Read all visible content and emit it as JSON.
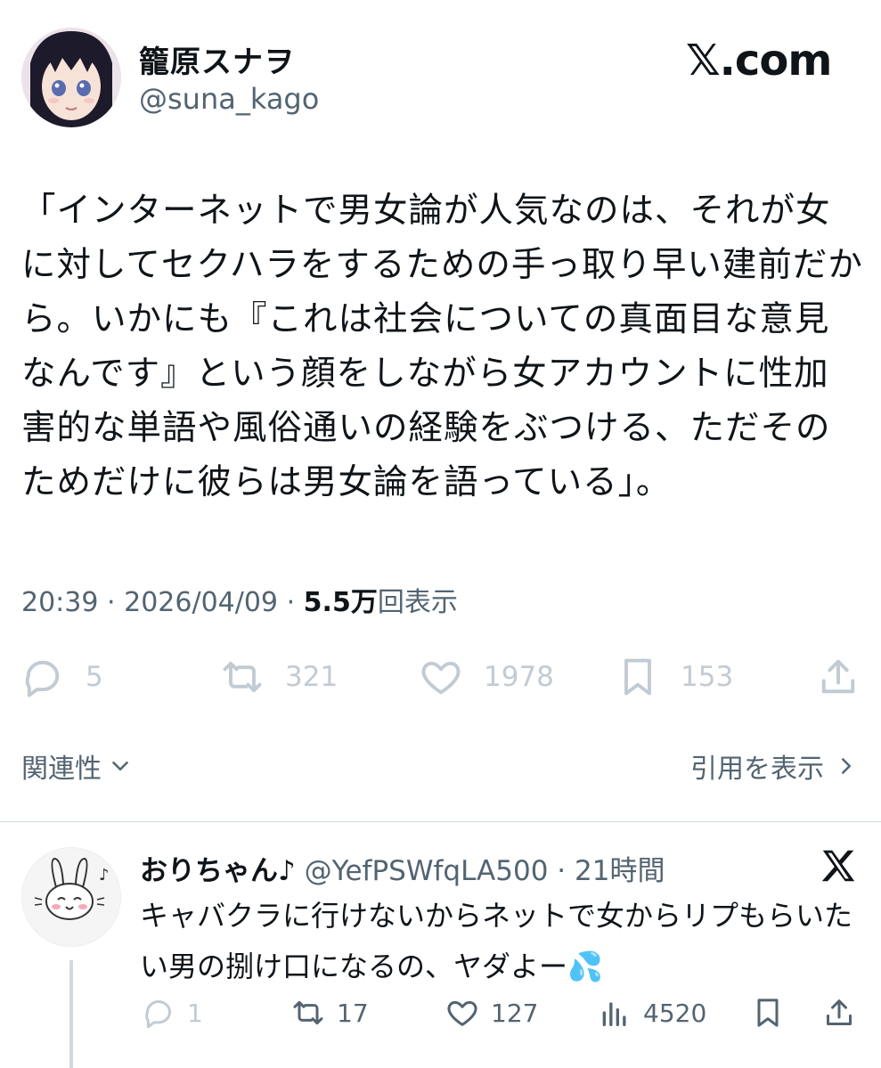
{
  "header": {
    "display_name": "籠原スナヲ",
    "handle": "@suna_kago",
    "site_label": "𝕏.com"
  },
  "tweet": {
    "text": "「インターネットで男女論が人気なのは、それが女に対してセクハラをするための手っ取り早い建前だから。いかにも『これは社会についての真面目な意見なんです』という顔をしながら女アカウントに性加害的な単語や風俗通いの経験をぶつける、ただそのためだけに彼らは男女論を語っている」。",
    "time": "20:39",
    "date": "2026/04/09",
    "views_count": "5.5万",
    "views_label": "回表示",
    "separator": "·"
  },
  "actions": {
    "replies": "5",
    "reposts": "321",
    "likes": "1978",
    "bookmarks": "153"
  },
  "links": {
    "relevance": "関連性",
    "view_quotes": "引用を表示"
  },
  "reply": {
    "name": "おりちゃん♪",
    "handle": "@YefPSWfqLA500",
    "separator": "·",
    "time": "21時間",
    "text": "キャバクラに行けないからネットで女からリプもらいたい男の捌け口になるの、ヤダよー💦",
    "replies": "1",
    "reposts": "17",
    "likes": "127",
    "views": "4520"
  },
  "colors": {
    "text": "#0f1419",
    "secondary": "#536471",
    "faded_icons": "#c2cbd3",
    "divider": "#cfd9de"
  },
  "icons": [
    "comment-icon",
    "repost-icon",
    "heart-icon",
    "bookmark-icon",
    "share-icon",
    "chevron-down-icon",
    "chevron-right-icon",
    "x-logo-icon",
    "views-icon"
  ]
}
